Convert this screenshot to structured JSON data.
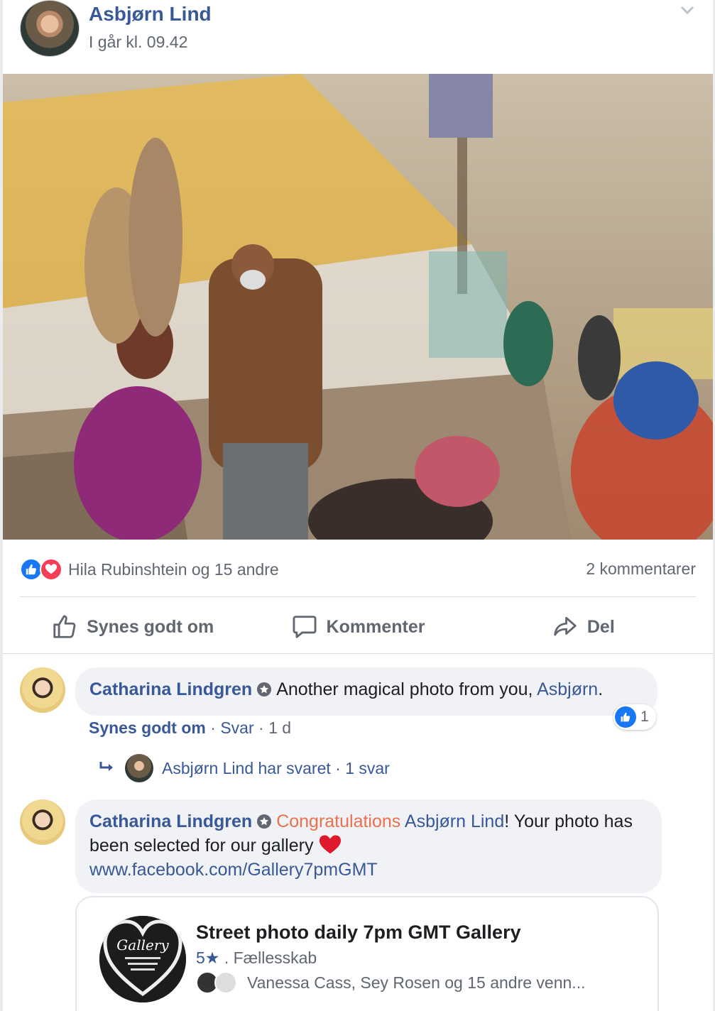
{
  "post": {
    "author": "Asbjørn Lind",
    "timestamp": "I går kl. 09.42",
    "reactions_text": "Hila Rubinshtein og 15 andre",
    "comments_count": "2 kommentarer"
  },
  "actions": {
    "like": "Synes godt om",
    "comment": "Kommenter",
    "share": "Del"
  },
  "comments": [
    {
      "name": "Catharina Lindgren",
      "text": "Another magical photo from you,",
      "mention": "Asbjørn",
      "end": ".",
      "like_label": "Synes godt om",
      "reply_label": "Svar",
      "age": "1 d",
      "like_count": "1",
      "separator": "·"
    },
    {
      "name": "Catharina Lindgren",
      "congrats": "Congratulations",
      "mention": "Asbjørn Lind",
      "text": "! Your photo has been selected for our gallery",
      "link": "www.facebook.com/Gallery7pmGMT"
    }
  ],
  "reply_thread": {
    "text": "Asbjørn Lind har svaret · 1 svar"
  },
  "link_preview": {
    "title": "Street photo daily 7pm GMT Gallery",
    "rating": "5★",
    "type": ". Fællesskab",
    "friends": "Vanessa Cass, Sey Rosen og 15 andre venn...",
    "logo_text": "Gallery"
  },
  "colors": {
    "link_blue": "#385898",
    "like_blue": "#1877f2",
    "love_red": "#f33e58",
    "congrats_orange": "#e9714f"
  }
}
